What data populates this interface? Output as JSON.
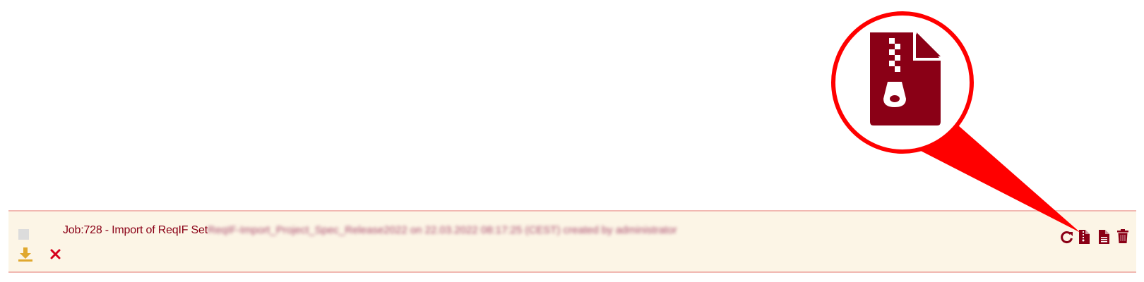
{
  "job": {
    "title": "Job:728 - Import of ReqIF Set",
    "details": "ReqIF-Import_Project_Spec_Release2022 on 22.03.2022 08:17:25 (CEST) created by administrator"
  },
  "icons": {
    "checkbox": "checkbox-square",
    "download": "download-icon",
    "cancel": "close-icon",
    "reload": "reload-icon",
    "zip": "zip-file-icon",
    "log": "log-file-icon",
    "delete": "trash-icon"
  },
  "colors": {
    "row_background": "#fcf5e6",
    "row_border": "#f1b8b2",
    "title_text": "#8a0016",
    "icon_dark_red": "#8a0016",
    "download_yellow": "#e0a82e",
    "cancel_red": "#d6001c",
    "callout_red": "#ff0000",
    "zip_icon_fill": "#8a0016"
  }
}
